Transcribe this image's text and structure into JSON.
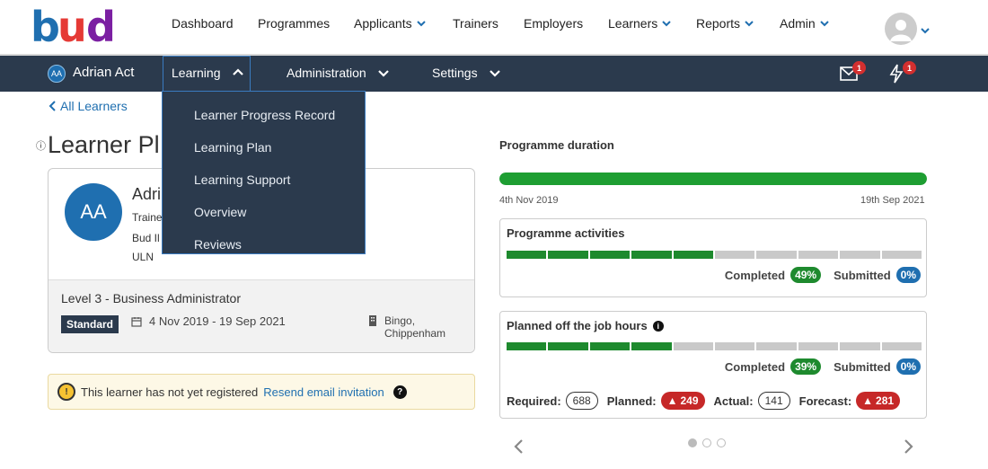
{
  "topnav": {
    "items": [
      {
        "label": "Dashboard"
      },
      {
        "label": "Programmes"
      },
      {
        "label": "Applicants"
      },
      {
        "label": "Trainers"
      },
      {
        "label": "Employers"
      },
      {
        "label": "Learners"
      },
      {
        "label": "Reports"
      },
      {
        "label": "Admin"
      }
    ],
    "brand_colors": [
      "#1f6fb0",
      "#e53935",
      "#7b1fa2",
      "#fbc02d"
    ]
  },
  "subnav": {
    "initials": "AA",
    "learner_name": "Adrian Act",
    "menus": [
      {
        "label": "Learning"
      },
      {
        "label": "Administration"
      },
      {
        "label": "Settings"
      }
    ],
    "mail_count": "1",
    "alerts_count": "1"
  },
  "dropdown": {
    "items": [
      {
        "label": "Learner Progress Record"
      },
      {
        "label": "Learning Plan"
      },
      {
        "label": "Learning Support"
      },
      {
        "label": "Overview"
      },
      {
        "label": "Reviews"
      }
    ]
  },
  "main": {
    "back_link": "All Learners",
    "title_visible": "Learner Pl",
    "card": {
      "initials": "AA",
      "name_visible": "Adri",
      "line1": "Traine",
      "line2": "Bud Il",
      "line3": "ULN",
      "course": "Level 3 - Business Administrator",
      "standard_badge": "Standard",
      "dates": "4 Nov 2019 - 19 Sep 2021",
      "location_line1": "Bingo,",
      "location_line2": "Chippenham"
    },
    "alert": {
      "text": "This learner has not yet registered",
      "link": "Resend email invitation"
    }
  },
  "right": {
    "duration_title": "Programme duration",
    "duration_progress": 1.0,
    "start_date": "4th Nov 2019",
    "end_date": "19th Sep 2021",
    "activities": {
      "title": "Programme activities",
      "segments_total": 10,
      "segments_filled": 5,
      "completed_label": "Completed",
      "completed_value": "49%",
      "submitted_label": "Submitted",
      "submitted_value": "0%"
    },
    "offjob": {
      "title": "Planned off the job hours",
      "segments_total": 10,
      "segments_filled": 4,
      "completed_label": "Completed",
      "completed_value": "39%",
      "submitted_label": "Submitted",
      "submitted_value": "0%",
      "required_label": "Required:",
      "required_value": "688",
      "planned_label": "Planned:",
      "planned_value": "249",
      "actual_label": "Actual:",
      "actual_value": "141",
      "forecast_label": "Forecast:",
      "forecast_value": "281"
    }
  }
}
